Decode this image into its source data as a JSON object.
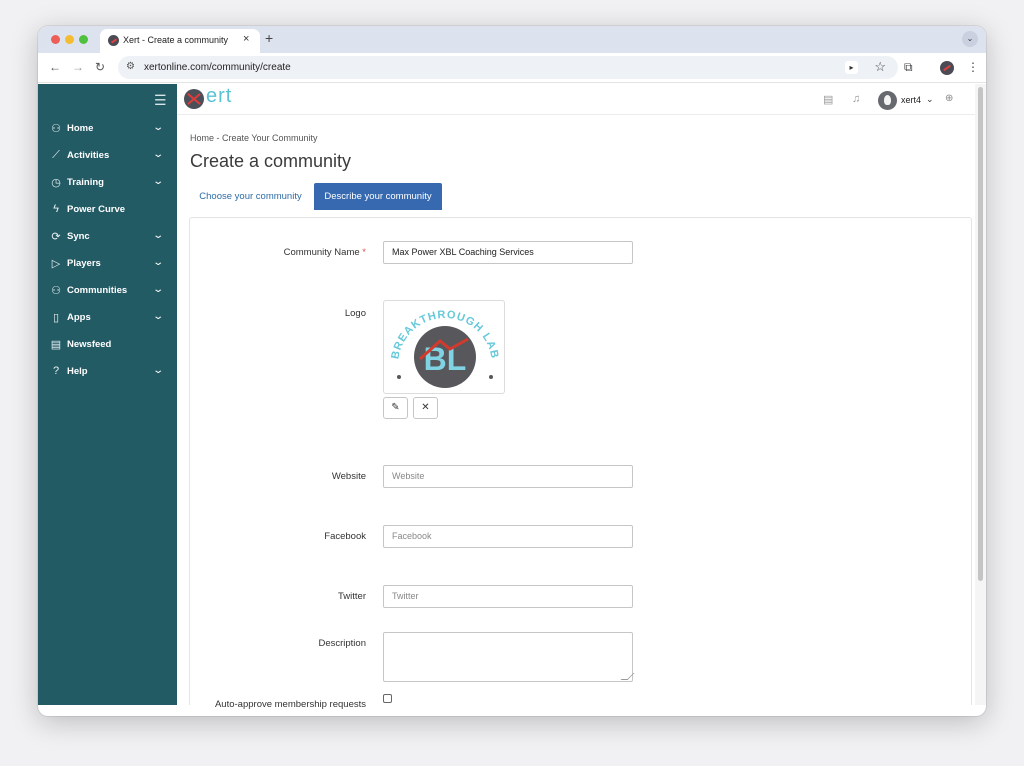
{
  "browser": {
    "tab_title": "Xert - Create a community",
    "tab_close": "×",
    "new_tab": "+",
    "url": "xertonline.com/community/create"
  },
  "sidebar": {
    "items": [
      {
        "label": "Home",
        "icon": "user-icon",
        "glyph": "⚇",
        "expandable": true
      },
      {
        "label": "Activities",
        "icon": "chart-line-icon",
        "glyph": "⟋",
        "expandable": true
      },
      {
        "label": "Training",
        "icon": "stopwatch-icon",
        "glyph": "◷",
        "expandable": true
      },
      {
        "label": "Power Curve",
        "icon": "lightning-icon",
        "glyph": "ϟ",
        "expandable": false
      },
      {
        "label": "Sync",
        "icon": "sync-icon",
        "glyph": "⟳",
        "expandable": true
      },
      {
        "label": "Players",
        "icon": "play-circle-icon",
        "glyph": "▷",
        "expandable": true
      },
      {
        "label": "Communities",
        "icon": "people-icon",
        "glyph": "⚇",
        "expandable": true
      },
      {
        "label": "Apps",
        "icon": "phone-icon",
        "glyph": "▯",
        "expandable": true
      },
      {
        "label": "Newsfeed",
        "icon": "newspaper-icon",
        "glyph": "▤",
        "expandable": false
      },
      {
        "label": "Help",
        "icon": "help-circle-icon",
        "glyph": "?",
        "expandable": true
      }
    ],
    "chevron": "⌄"
  },
  "header": {
    "logo_text": "ert",
    "user_name": "xert4",
    "user_chevron": "⌄",
    "plus": "⊕"
  },
  "page": {
    "breadcrumb": "Home - Create Your Community",
    "title": "Create a community",
    "tabs": [
      {
        "label": "Choose your community",
        "active": false
      },
      {
        "label": "Describe your community",
        "active": true
      }
    ]
  },
  "form": {
    "community_name_label": "Community Name",
    "required_mark": "*",
    "community_name_value": "Max Power XBL Coaching Services",
    "logo_label": "Logo",
    "logo_text_top": "BREAKTHROUGH LAB",
    "logo_text_mono": "BL",
    "edit_button": "✎",
    "remove_button": "✕",
    "website_label": "Website",
    "website_placeholder": "Website",
    "facebook_label": "Facebook",
    "facebook_placeholder": "Facebook",
    "twitter_label": "Twitter",
    "twitter_placeholder": "Twitter",
    "description_label": "Description",
    "auto_approve_label": "Auto-approve membership requests",
    "auto_approve_checked": false
  },
  "colors": {
    "sidebar_bg": "#235b65",
    "active_tab_bg": "#3669b0",
    "link": "#2e6ba7",
    "logo_accent": "#59c3d3",
    "required": "#d9534f"
  }
}
